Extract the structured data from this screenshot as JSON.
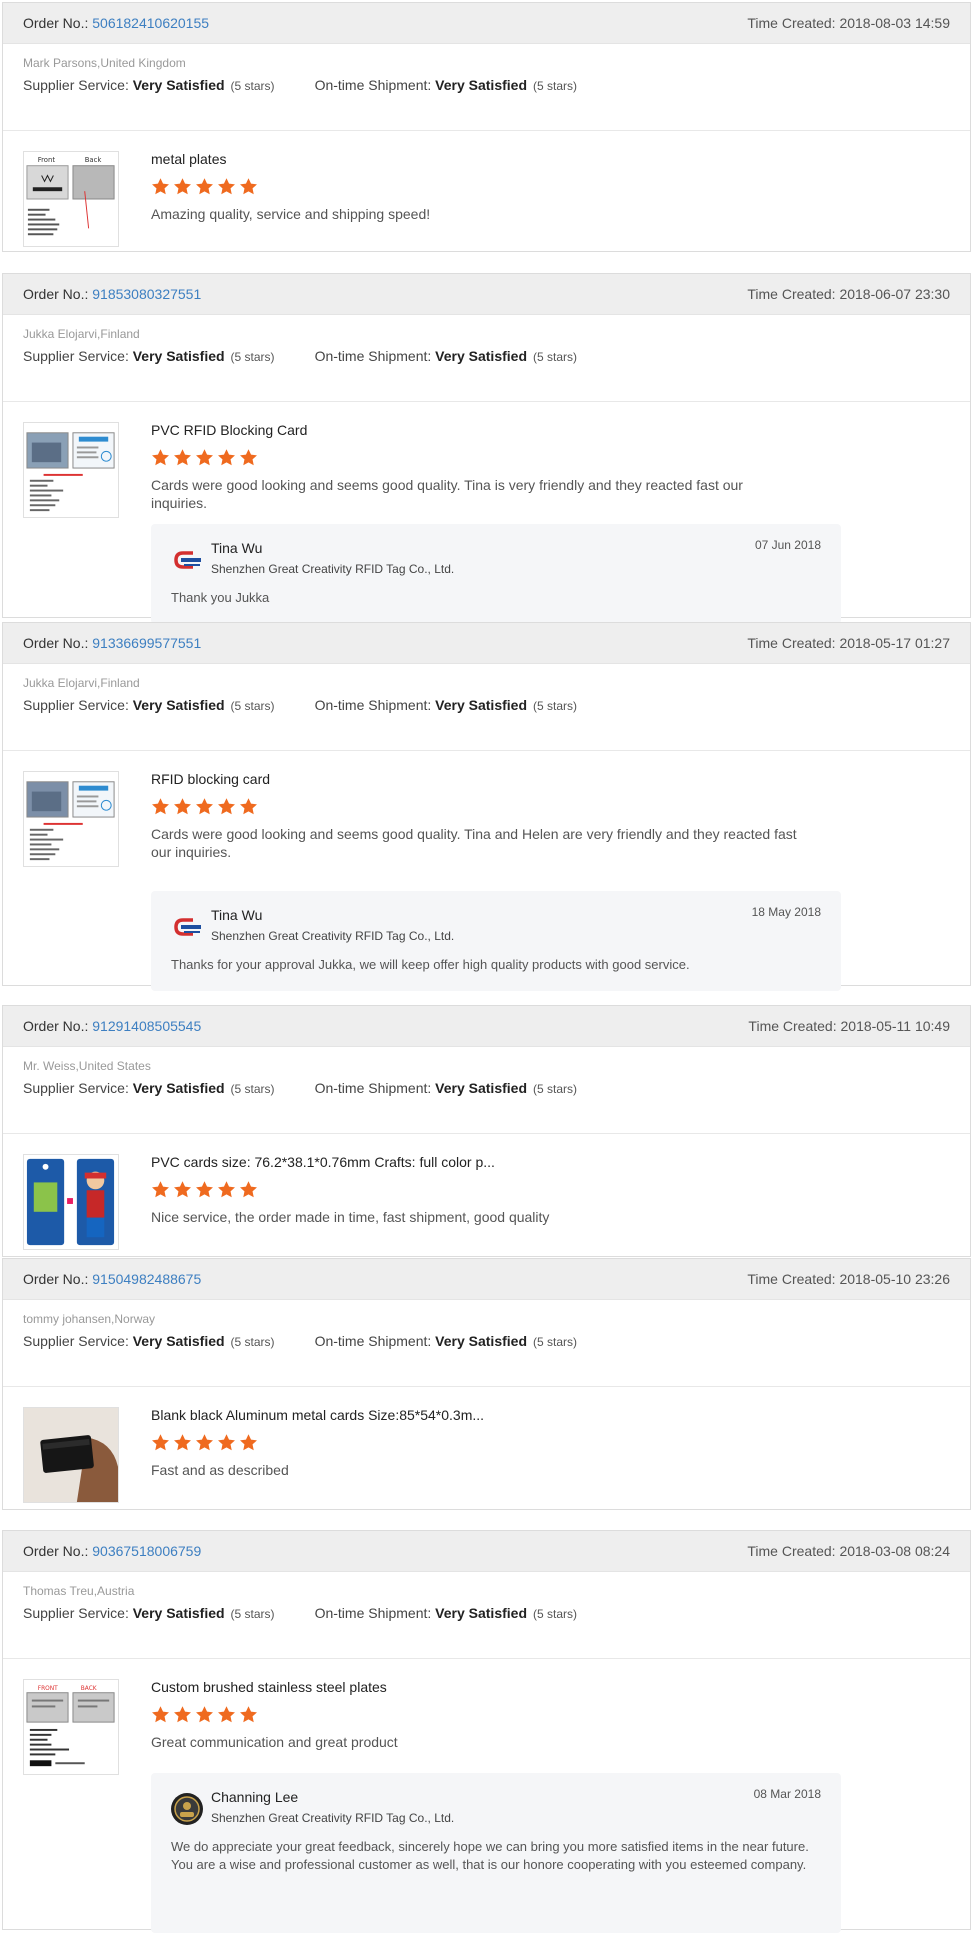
{
  "labels": {
    "order_no": "Order No.: ",
    "time_created": "Time Created: ",
    "supplier_service": "Supplier Service: ",
    "ontime_shipment": "On-time Shipment: "
  },
  "colors": {
    "star": "#ef6a1f",
    "order_link": "#3d7fc1"
  },
  "reviews": [
    {
      "order_no": "506182410620155",
      "time_created": "2018-08-03 14:59",
      "buyer": "Mark Parsons,United Kingdom",
      "supplier_rating": "Very Satisfied",
      "supplier_stars": "(5 stars)",
      "shipment_rating": "Very Satisfied",
      "shipment_stars": "(5 stars)",
      "product_title": "metal plates",
      "stars": 5,
      "text": "Amazing quality, service and shipping speed!",
      "thumb_icon": "metal-plate-thumbnail",
      "thumb_label_front": "Front",
      "thumb_label_back": "Back",
      "thumb_brand": "JUDNAY"
    },
    {
      "order_no": "91853080327551",
      "time_created": "2018-06-07 23:30",
      "buyer": "Jukka Elojarvi,Finland",
      "supplier_rating": "Very Satisfied",
      "supplier_stars": "(5 stars)",
      "shipment_rating": "Very Satisfied",
      "shipment_stars": "(5 stars)",
      "product_title": "PVC RFID Blocking Card",
      "stars": 5,
      "text": "Cards were good looking and seems good quality. Tina is very friendly and they reacted fast our inquiries.",
      "thumb_icon": "pvc-card-thumbnail",
      "reply": {
        "name": "Tina Wu",
        "company": "Shenzhen Great Creativity RFID Tag Co., Ltd.",
        "date": "07 Jun 2018",
        "text": "Thank you Jukka",
        "logo_icon": "company-logo-icon"
      }
    },
    {
      "order_no": "91336699577551",
      "time_created": "2018-05-17 01:27",
      "buyer": "Jukka Elojarvi,Finland",
      "supplier_rating": "Very Satisfied",
      "supplier_stars": "(5 stars)",
      "shipment_rating": "Very Satisfied",
      "shipment_stars": "(5 stars)",
      "product_title": "RFID blocking card",
      "stars": 5,
      "text": "Cards were good looking and seems good quality. Tina and Helen are very friendly and they reacted fast our inquiries.",
      "thumb_icon": "rfid-card-thumbnail",
      "reply": {
        "name": "Tina Wu",
        "company": "Shenzhen Great Creativity RFID Tag Co., Ltd.",
        "date": "18 May 2018",
        "text": "Thanks for your approval Jukka, we will keep offer high quality products with good service.",
        "logo_icon": "company-logo-icon"
      }
    },
    {
      "order_no": "91291408505545",
      "time_created": "2018-05-11 10:49",
      "buyer": "Mr. Weiss,United States",
      "supplier_rating": "Very Satisfied",
      "supplier_stars": "(5 stars)",
      "shipment_rating": "Very Satisfied",
      "shipment_stars": "(5 stars)",
      "product_title": "PVC cards size: 76.2*38.1*0.76mm Crafts: full color p...",
      "stars": 5,
      "text": "Nice service, the order made in time, fast shipment, good quality",
      "thumb_icon": "color-card-thumbnail"
    },
    {
      "order_no": "91504982488675",
      "time_created": "2018-05-10 23:26",
      "buyer": "tommy johansen,Norway",
      "supplier_rating": "Very Satisfied",
      "supplier_stars": "(5 stars)",
      "shipment_rating": "Very Satisfied",
      "shipment_stars": "(5 stars)",
      "product_title": "Blank black Aluminum metal cards Size:85*54*0.3m...",
      "stars": 5,
      "text": "Fast and as described",
      "thumb_icon": "black-card-thumbnail"
    },
    {
      "order_no": "90367518006759",
      "time_created": "2018-03-08 08:24",
      "buyer": "Thomas Treu,Austria",
      "supplier_rating": "Very Satisfied",
      "supplier_stars": "(5 stars)",
      "shipment_rating": "Very Satisfied",
      "shipment_stars": "(5 stars)",
      "product_title": "Custom brushed stainless steel plates",
      "stars": 5,
      "text": "Great communication and great product",
      "thumb_icon": "steel-plate-thumbnail",
      "reply": {
        "name": "Channing Lee",
        "company": "Shenzhen Great Creativity RFID Tag Co., Ltd.",
        "date": "08 Mar 2018",
        "text": "We do appreciate your great feedback, sincerely hope we can bring you more satisfied items in the near future.\nYou are a wise and professional customer as well, that is our honore cooperating with you esteemed company.",
        "logo_icon": "avatar-icon"
      }
    }
  ]
}
